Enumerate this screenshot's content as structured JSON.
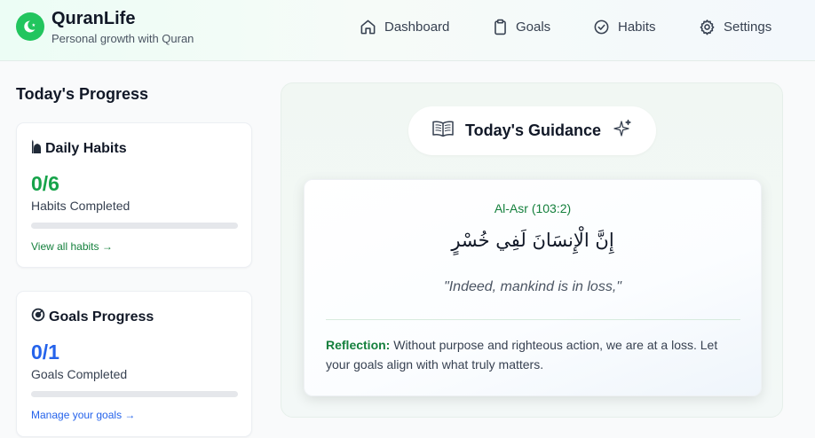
{
  "header": {
    "app_title": "QuranLife",
    "subtitle": "Personal growth with Quran",
    "nav": [
      {
        "label": "Dashboard",
        "icon": "home-icon"
      },
      {
        "label": "Goals",
        "icon": "clipboard-icon"
      },
      {
        "label": "Habits",
        "icon": "check-circle-icon"
      },
      {
        "label": "Settings",
        "icon": "gear-icon"
      }
    ]
  },
  "progress": {
    "title": "Today's Progress",
    "habits": {
      "title": "Daily Habits",
      "icon": "mosque-icon",
      "count": "0/6",
      "label": "Habits Completed",
      "fraction": 0,
      "link": "View all habits →",
      "color": "#16a34a"
    },
    "goals": {
      "title": "Goals Progress",
      "icon": "target-icon",
      "count": "0/1",
      "label": "Goals Completed",
      "fraction": 0,
      "link": "Manage your goals →",
      "color": "#2563eb"
    }
  },
  "guidance": {
    "title": "Today's Guidance",
    "title_icon": "open-book-icon",
    "decor_icon": "sparkle-icon",
    "verse": {
      "reference": "Al-Asr (103:2)",
      "arabic": "إِنَّ الْإِنسَانَ لَفِي خُسْرٍ",
      "translation": "\"Indeed, mankind is in loss,\"",
      "reflection_label": "Reflection:",
      "reflection_text": "Without purpose and righteous action, we are at a loss. Let your goals align with what truly matters."
    }
  },
  "colors": {
    "accent_green": "#22c55e",
    "green_text": "#15803d",
    "blue_text": "#2563eb"
  }
}
